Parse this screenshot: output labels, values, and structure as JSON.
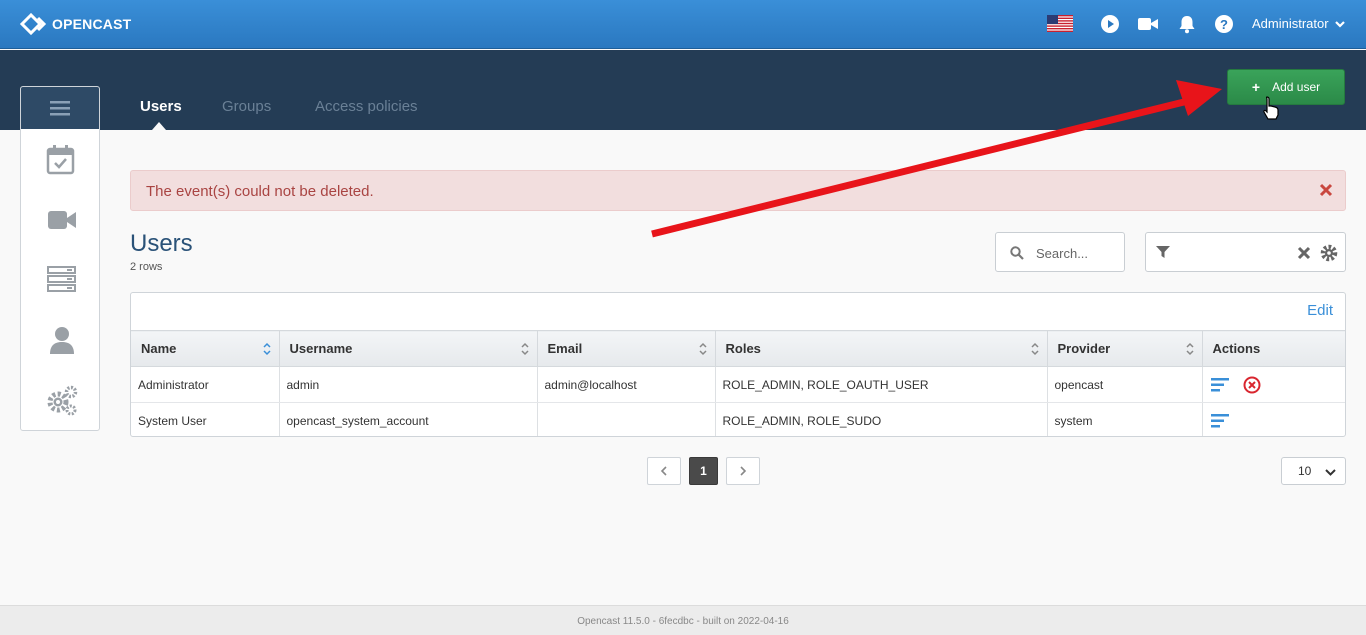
{
  "app": {
    "brand": "OPENCAST"
  },
  "header": {
    "user_label": "Administrator",
    "language_icon": "us-flag-icon"
  },
  "nav": {
    "tabs": [
      {
        "label": "Users",
        "active": true
      },
      {
        "label": "Groups",
        "active": false
      },
      {
        "label": "Access policies",
        "active": false
      }
    ],
    "add_button_label": "Add user"
  },
  "alert": {
    "message": "The event(s) could not be deleted.",
    "type": "error"
  },
  "page": {
    "title": "Users",
    "row_count": "2 rows"
  },
  "search": {
    "placeholder": "Search..."
  },
  "table": {
    "edit_label": "Edit",
    "columns": [
      "Name",
      "Username",
      "Email",
      "Roles",
      "Provider",
      "Actions"
    ],
    "rows": [
      {
        "name": "Administrator",
        "username": "admin",
        "email": "admin@localhost",
        "roles": "ROLE_ADMIN, ROLE_OAUTH_USER",
        "provider": "opencast",
        "deletable": true
      },
      {
        "name": "System User",
        "username": "opencast_system_account",
        "email": "",
        "roles": "ROLE_ADMIN, ROLE_SUDO",
        "provider": "system",
        "deletable": false
      }
    ]
  },
  "pagination": {
    "current_page": "1",
    "page_size": "10"
  },
  "footer": {
    "text": "Opencast 11.5.0 - 6fecdbc - built on 2022-04-16"
  },
  "colors": {
    "topbar": "#3a8fd8",
    "subnav": "#243c55",
    "add_button": "#2b8a48",
    "alert_text": "#a94442",
    "link": "#3a8fd8",
    "annotation_arrow": "#e8141a"
  }
}
